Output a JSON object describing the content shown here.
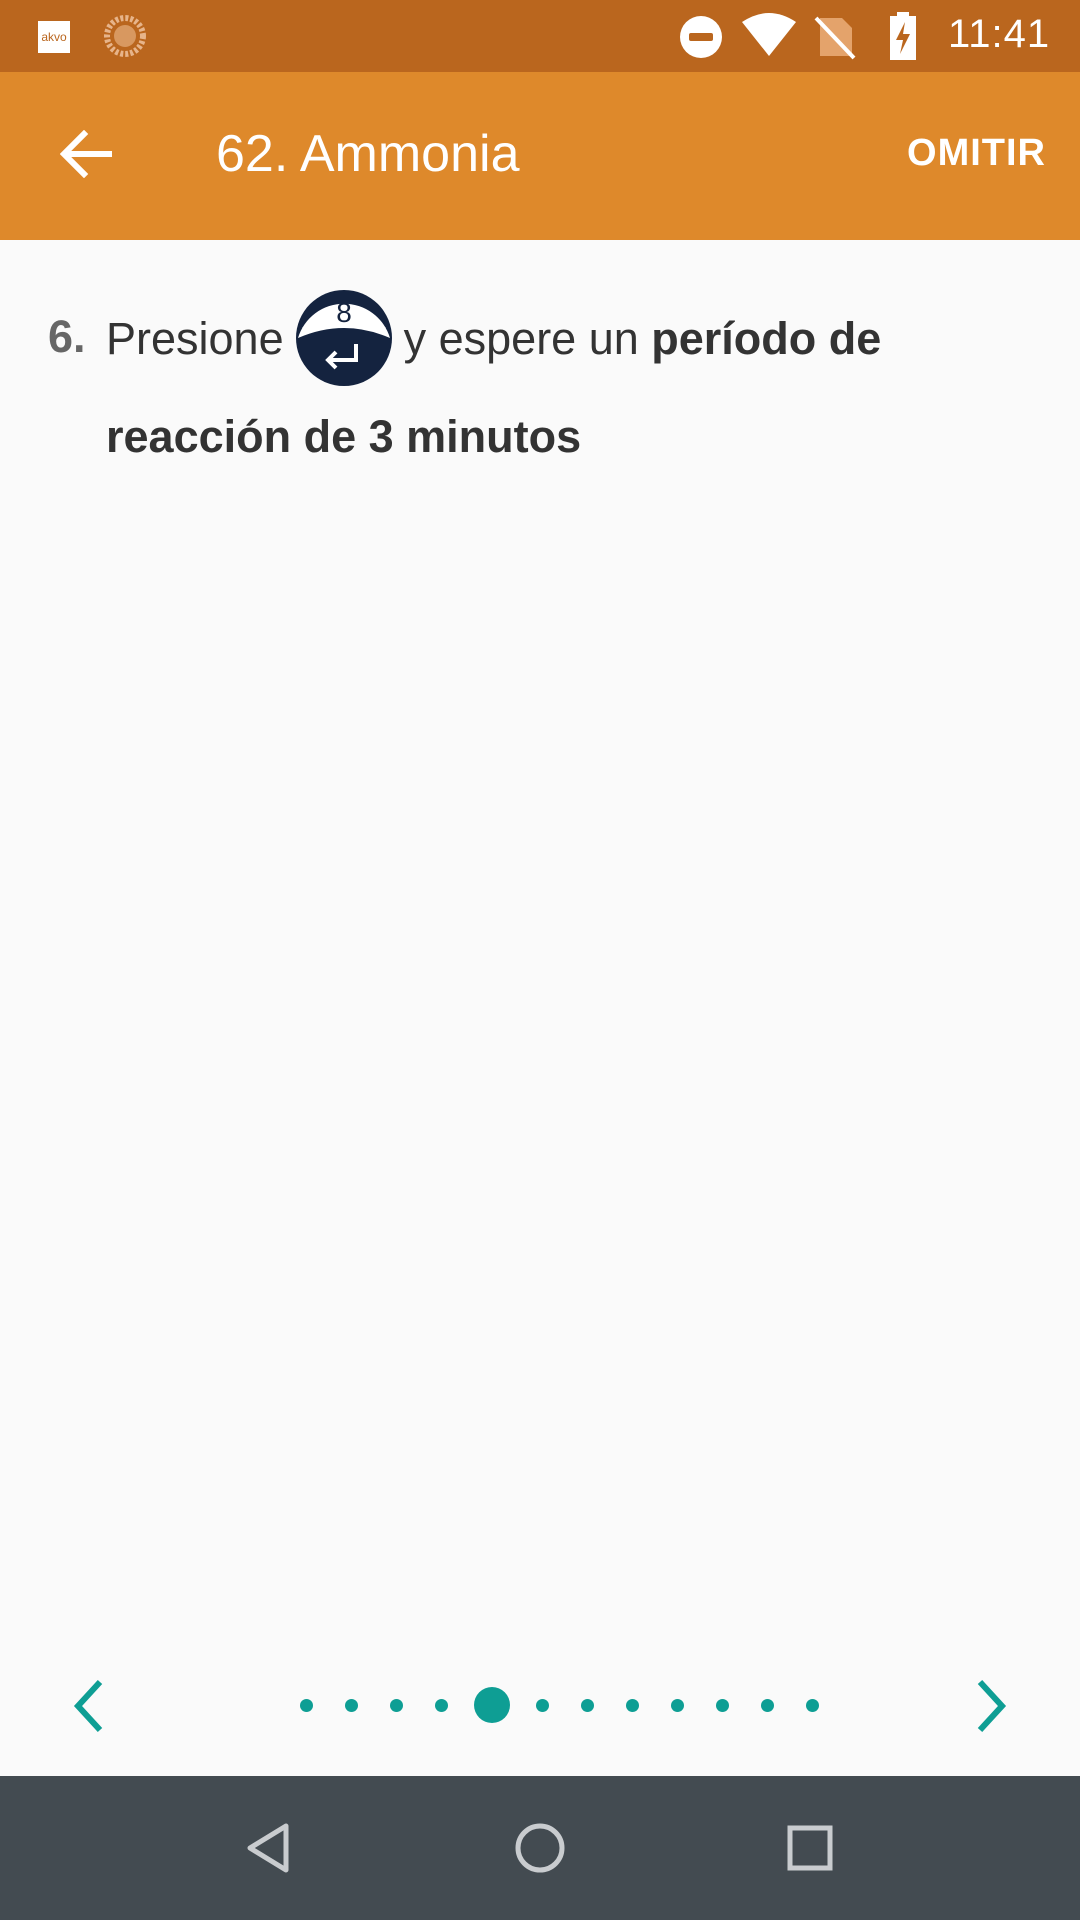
{
  "status_bar": {
    "app_icon_text": "akvo",
    "time": "11:41",
    "icons": [
      "akvo-icon",
      "sync-icon",
      "do-not-disturb-icon",
      "wifi-icon",
      "no-sim-icon",
      "battery-charging-icon"
    ]
  },
  "app_bar": {
    "title": "62. Ammonia",
    "skip_label": "OMITIR",
    "back_icon": "arrow-back-icon",
    "background_color": "#de892b"
  },
  "instruction": {
    "step_number": "6.",
    "text_before": "Presione",
    "key_label": "8",
    "text_middle": "y espere un",
    "text_bold": "período de reacción de 3 minutos"
  },
  "pager": {
    "total_pages": 12,
    "current_page": 5,
    "accent_color": "#0e9e94",
    "prev_icon": "chevron-left-icon",
    "next_icon": "chevron-right-icon"
  },
  "nav_bar": {
    "buttons": [
      "nav-back-icon",
      "nav-home-icon",
      "nav-recents-icon"
    ]
  }
}
